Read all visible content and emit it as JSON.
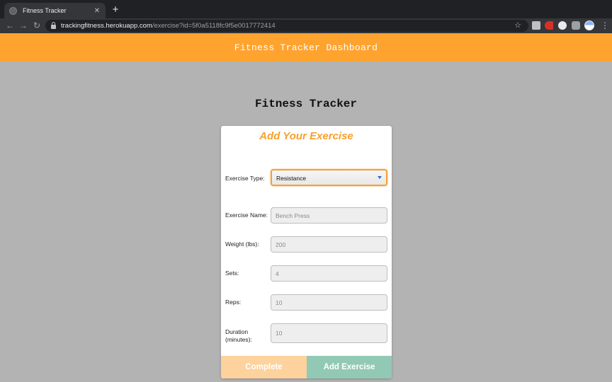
{
  "browser": {
    "tab_title": "Fitness Tracker",
    "tab_close": "✕",
    "new_tab": "+",
    "url_host": "trackingfitness.herokuapp.com",
    "url_path": "/exercise?id=5f0a5118fc9f5e0017772414",
    "icons": {
      "back": "arrow-left-icon",
      "forward": "arrow-right-icon",
      "reload": "reload-icon",
      "star": "star-icon",
      "menu": "more-vertical-icon"
    },
    "back_glyph": "←",
    "forward_glyph": "→",
    "reload_glyph": "↻",
    "star_glyph": "☆",
    "menu_glyph": "⋮"
  },
  "app": {
    "header_title": "Fitness Tracker Dashboard",
    "page_title": "Fitness Tracker",
    "accent_color": "#ffa32f"
  },
  "form": {
    "title": "Add Your Exercise",
    "exercise_type": {
      "label": "Exercise Type:",
      "value": "Resistance"
    },
    "exercise_name": {
      "label": "Exercise Name:",
      "value": "Bench Press"
    },
    "weight": {
      "label": "Weight (lbs):",
      "value": "200"
    },
    "sets": {
      "label": "Sets:",
      "value": "4"
    },
    "reps": {
      "label": "Reps:",
      "value": "10"
    },
    "duration": {
      "label_line1": "Duration",
      "label_line2": "(minutes):",
      "value": "10"
    },
    "complete_button": "Complete",
    "add_button": "Add Exercise"
  }
}
